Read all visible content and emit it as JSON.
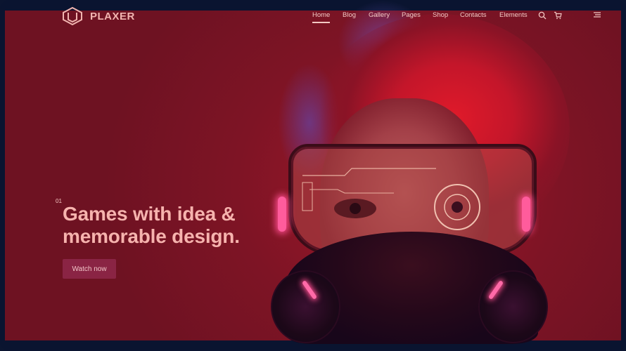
{
  "brand": {
    "name": "PLAXER",
    "logo_icon": "hexagon-shield-logo"
  },
  "nav": {
    "items": [
      "Home",
      "Blog",
      "Gallery",
      "Pages",
      "Shop",
      "Contacts",
      "Elements"
    ],
    "active": "Home"
  },
  "icons": {
    "search": "search-icon",
    "cart": "cart-icon",
    "menu": "hamburger-menu-icon"
  },
  "hero": {
    "index": "01",
    "title_line1": "Games with idea &",
    "title_line2": "memorable design.",
    "cta_label": "Watch now"
  },
  "colors": {
    "overlay": "#7e1425",
    "text": "#f6b3ae",
    "button_bg": "#8a2444",
    "frame": "#0a1430",
    "neon": "#ff5c9c"
  }
}
